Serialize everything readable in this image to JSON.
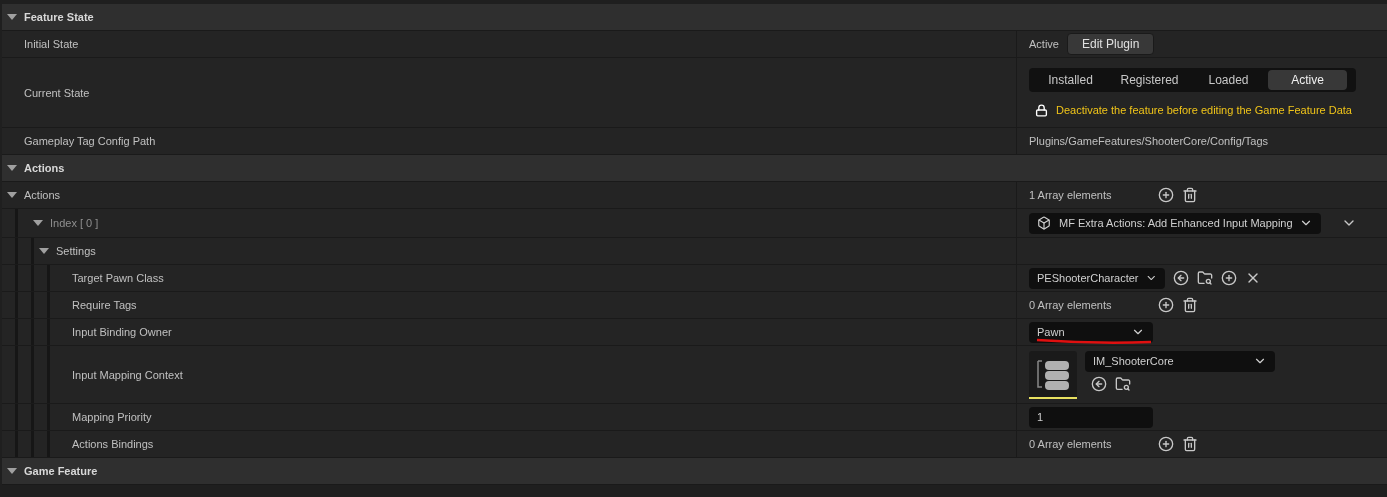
{
  "sections": [
    {
      "title": "Feature State",
      "expanded": true,
      "rows": [
        {
          "label": "Initial State",
          "value": {
            "kind": "state_button",
            "text": "Active",
            "button": "Edit Plugin"
          }
        },
        {
          "label": "Current State",
          "value": {
            "kind": "segmented",
            "options": [
              {
                "label": "Installed",
                "selected": false
              },
              {
                "label": "Registered",
                "selected": false
              },
              {
                "label": "Loaded",
                "selected": false
              },
              {
                "label": "Active",
                "selected": true
              }
            ],
            "warning": "Deactivate the feature before editing the Game Feature Data"
          }
        },
        {
          "label": "Gameplay Tag Config Path",
          "value": {
            "kind": "text",
            "text": "Plugins/GameFeatures/ShooterCore/Config/Tags"
          }
        }
      ]
    },
    {
      "title": "Actions",
      "expanded": true,
      "rows": [
        {
          "label": "Actions",
          "expanded": true,
          "value": {
            "kind": "array",
            "text": "1 Array elements"
          },
          "children": [
            {
              "label": "Index [ 0 ]",
              "expanded": true,
              "dim": true,
              "value": {
                "kind": "class_picker",
                "text": "MF Extra Actions: Add Enhanced Input Mapping"
              },
              "children": [
                {
                  "label": "Settings",
                  "expanded": true,
                  "children": [
                    {
                      "label": "Target Pawn Class",
                      "value": {
                        "kind": "class_select",
                        "text": "PEShooterCharacter"
                      }
                    },
                    {
                      "label": "Require Tags",
                      "value": {
                        "kind": "array",
                        "text": "0 Array elements"
                      }
                    },
                    {
                      "label": "Input Binding Owner",
                      "value": {
                        "kind": "enum",
                        "text": "Pawn",
                        "annotated": true
                      }
                    },
                    {
                      "label": "Input Mapping Context",
                      "value": {
                        "kind": "asset",
                        "text": "IM_ShooterCore"
                      }
                    },
                    {
                      "label": "Mapping Priority",
                      "value": {
                        "kind": "number",
                        "text": "1"
                      }
                    },
                    {
                      "label": "Actions Bindings",
                      "value": {
                        "kind": "array",
                        "text": "0 Array elements"
                      }
                    }
                  ]
                }
              ]
            }
          ]
        }
      ]
    },
    {
      "title": "Game Feature",
      "expanded": true
    }
  ]
}
